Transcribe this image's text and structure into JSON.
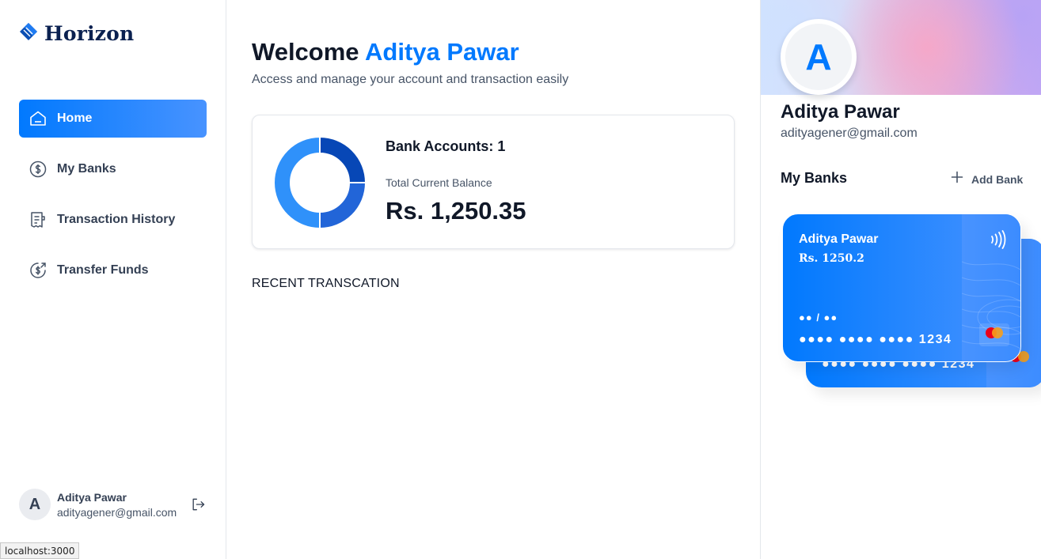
{
  "brand": {
    "name": "Horizon"
  },
  "sidebar": {
    "items": [
      {
        "label": "Home",
        "icon": "home-icon",
        "active": true
      },
      {
        "label": "My Banks",
        "icon": "dollar-circle-icon",
        "active": false
      },
      {
        "label": "Transaction History",
        "icon": "receipt-icon",
        "active": false
      },
      {
        "label": "Transfer Funds",
        "icon": "money-send-icon",
        "active": false
      }
    ],
    "user": {
      "initial": "A",
      "name": "Aditya Pawar",
      "email": "adityagener@gmail.com"
    }
  },
  "header": {
    "greeting": "Welcome",
    "user_name": "Aditya Pawar",
    "subtitle": "Access and manage your account and transaction easily"
  },
  "balance": {
    "bank_accounts_label": "Bank Accounts: 1",
    "total_label": "Total Current Balance",
    "total_value": "Rs. 1,250.35"
  },
  "chart_data": {
    "type": "pie",
    "values": [
      25,
      25,
      50
    ],
    "colors": [
      "#0747b6",
      "#2265d8",
      "#2f91fa"
    ]
  },
  "recent": {
    "title": "RECENT TRANSCATION"
  },
  "profile": {
    "initial": "A",
    "name": "Aditya Pawar",
    "email": "adityagener@gmail.com"
  },
  "banks": {
    "title": "My Banks",
    "add_label": "Add Bank",
    "cards": [
      {
        "holder": "Aditya Pawar",
        "balance": "Rs. 1250.2",
        "expiry": "●● / ●●",
        "number": "●●●● ●●●● ●●●● 1234"
      },
      {
        "number": "●●●● ●●●● ●●●● 1234"
      }
    ]
  },
  "status_url": "localhost:3000",
  "colors": {
    "accent": "#0179fe",
    "text": "#101828",
    "muted": "#475467"
  }
}
